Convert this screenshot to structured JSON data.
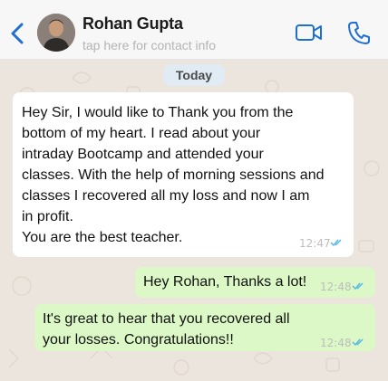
{
  "header": {
    "contact_name": "Rohan Gupta",
    "subtitle": "tap here for contact info",
    "icons": [
      "back-icon",
      "avatar",
      "video-call-icon",
      "phone-call-icon"
    ]
  },
  "chat": {
    "date_label": "Today",
    "messages": [
      {
        "direction": "incoming",
        "lines": [
          "Hey Sir, I would like to Thank you from the",
          "bottom of my heart. I read about your",
          "intraday Bootcamp and attended your",
          "classes. With the help of morning sessions and",
          "classes I recovered all my loss and now I am",
          "in profit.",
          "You are the best teacher."
        ],
        "time": "12:47",
        "status": "read"
      },
      {
        "direction": "outgoing",
        "lines": [
          "Hey Rohan, Thanks a lot!"
        ],
        "time": "12:48",
        "status": "read"
      },
      {
        "direction": "outgoing",
        "lines": [
          "It's great to hear that you recovered all",
          "your losses. Congratulations!!"
        ],
        "time": "12:48",
        "status": "read"
      }
    ]
  },
  "colors": {
    "accent": "#1f6fd1",
    "incoming_bubble": "#ffffff",
    "outgoing_bubble": "#dcf8c6",
    "chat_background": "#ece5dd",
    "read_ticks": "#4fb6ec"
  }
}
